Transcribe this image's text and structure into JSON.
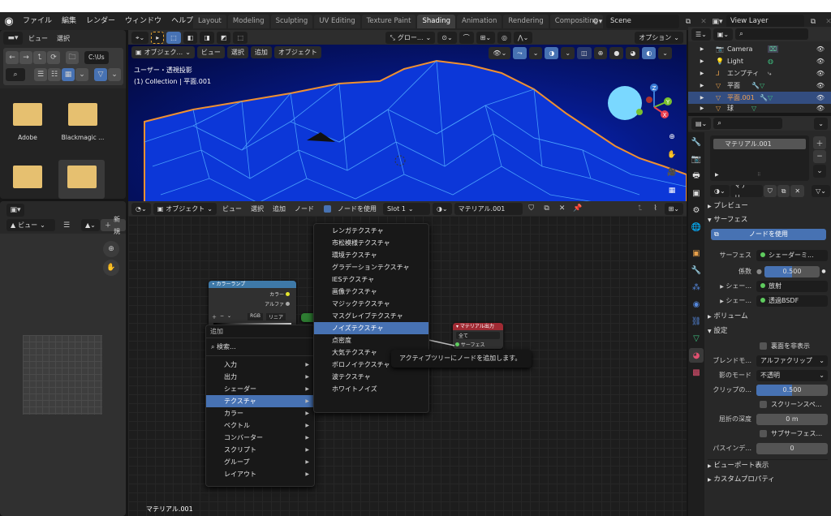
{
  "topbar": {
    "app_icon": "blender-logo-icon",
    "menu": [
      "ファイル",
      "編集",
      "レンダー",
      "ウィンドウ",
      "ヘルプ"
    ],
    "workspace_tabs": [
      {
        "label": "Layout",
        "active": false
      },
      {
        "label": "Modeling",
        "active": false
      },
      {
        "label": "Sculpting",
        "active": false
      },
      {
        "label": "UV Editing",
        "active": false
      },
      {
        "label": "Texture Paint",
        "active": false
      },
      {
        "label": "Shading",
        "active": true
      },
      {
        "label": "Animation",
        "active": false
      },
      {
        "label": "Rendering",
        "active": false
      },
      {
        "label": "Compositing",
        "active": false
      }
    ],
    "scene": "Scene",
    "view_layer": "View Layer"
  },
  "file_browser": {
    "menu": [
      "ビュー",
      "選択"
    ],
    "path": "C:\\Us",
    "folders": [
      "Adobe",
      "Blackmagic ...",
      "",
      ""
    ]
  },
  "image_editor": {
    "view_label": "ビュー",
    "new_label": "新規"
  },
  "viewport": {
    "mode": "オブジェク...",
    "menu": [
      "ビュー",
      "選択",
      "追加",
      "オブジェクト"
    ],
    "transform": "グロー...",
    "options": "オプション",
    "view_name": "ユーザー・透視投影",
    "collection": "(1) Collection | 平面.001",
    "gizmo": {
      "x": "X",
      "y": "Y",
      "z": "Z"
    }
  },
  "outliner": {
    "items": [
      {
        "name": "Camera",
        "color": "#e8a04a",
        "selected": false
      },
      {
        "name": "Light",
        "color": "#e8a04a",
        "selected": false
      },
      {
        "name": "エンプティ",
        "color": "#e8a04a",
        "selected": false
      },
      {
        "name": "平面",
        "color": "#e8a04a",
        "selected": false
      },
      {
        "name": "平面.001",
        "color": "#e8a04a",
        "selected": true
      },
      {
        "name": "球",
        "color": "#e8a04a",
        "selected": false
      }
    ]
  },
  "node_editor": {
    "mode": "オブジェクト",
    "menu": [
      "ビュー",
      "選択",
      "追加",
      "ノード"
    ],
    "use_nodes": "ノードを使用",
    "slot": "Slot 1",
    "material": "マテリアル.001",
    "footer_label": "マテリアル.001",
    "colorramp_node": {
      "title": "カラーランプ",
      "outputs": [
        "カラー",
        "アルファ"
      ],
      "mode": "RGB",
      "interp": "リニア"
    },
    "output_node": {
      "title": "マテリアル出力",
      "target": "全て",
      "input": "サーフェス"
    },
    "add_menu": {
      "title": "追加",
      "search": "検索...",
      "items": [
        "入力",
        "出力",
        "シェーダー",
        "テクスチャ",
        "カラー",
        "ベクトル",
        "コンバーター",
        "スクリプト",
        "グループ",
        "レイアウト"
      ],
      "selected": "テクスチャ"
    },
    "texture_submenu": {
      "items": [
        "レンガテクスチャ",
        "市松模様テクスチャ",
        "環境テクスチャ",
        "グラデーションテクスチャ",
        "IESテクスチャ",
        "画像テクスチャ",
        "マジックテクスチャ",
        "マスグレイブテクスチャ",
        "ノイズテクスチャ",
        "点密度",
        "大気テクスチャ",
        "ボロノイテクスチャ",
        "波テクスチャ",
        "ホワイトノイズ"
      ],
      "selected": "ノイズテクスチャ"
    },
    "tooltip": "アクティブツリーにノードを追加します。"
  },
  "properties": {
    "material_slot": "マテリアル.001",
    "material_name": "マテリ...",
    "sections": {
      "preview": "プレビュー",
      "surface": "サーフェス",
      "volume": "ボリューム",
      "settings": "設定",
      "viewport_display": "ビューポート表示",
      "custom_props": "カスタムプロパティ"
    },
    "use_nodes": "ノードを使用",
    "surface_label": "サーフェス",
    "surface_value": "シェーダーミ...",
    "fac_label": "係数",
    "fac_value": "0.500",
    "fac_fraction": 0.5,
    "shader1_label": "シェー...",
    "shader1_value": "放射",
    "shader2_label": "シェー...",
    "shader2_value": "透過BSDF",
    "backface": "裏面を非表示",
    "blend_label": "ブレンドモ...",
    "blend_value": "アルファクリップ",
    "shadow_label": "影のモード",
    "shadow_value": "不透明",
    "clip_label": "クリップの...",
    "clip_value": "0.500",
    "clip_fraction": 0.5,
    "screen_space": "スクリーンスペ...",
    "refraction_label": "屈折の深度",
    "refraction_value": "0 m",
    "subsurface": "サブサーフェス...",
    "pass_label": "パスインデ...",
    "pass_value": "0"
  }
}
